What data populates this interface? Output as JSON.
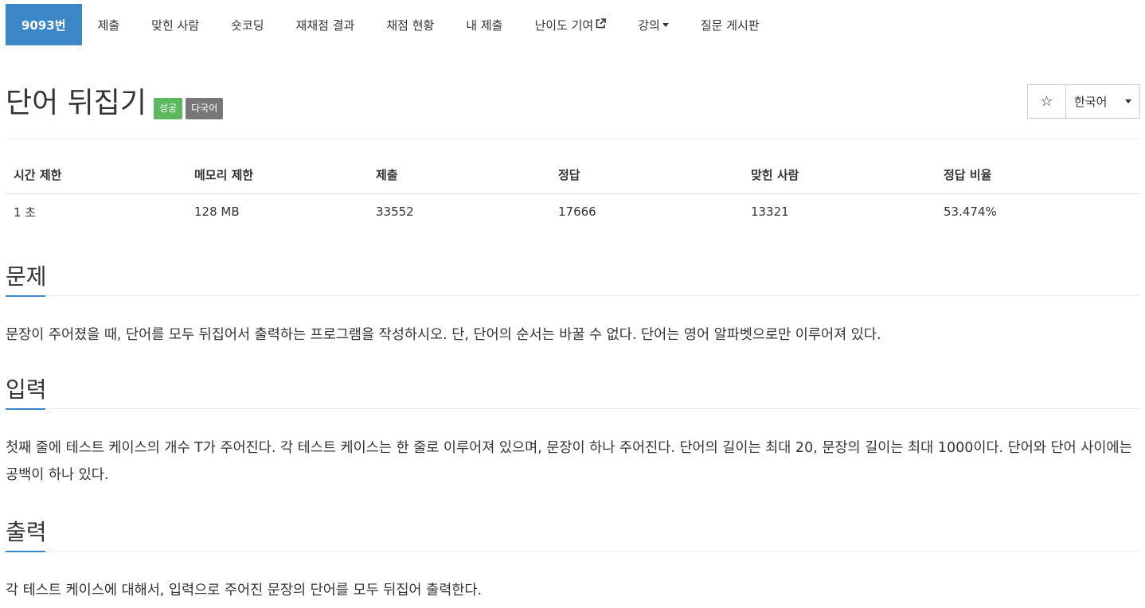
{
  "nav": {
    "problem_id": "9093번",
    "items": [
      "제출",
      "맞힌 사람",
      "숏코딩",
      "재채점 결과",
      "채점 현황",
      "내 제출",
      "난이도 기여",
      "강의",
      "질문 게시판"
    ]
  },
  "problem": {
    "title": "단어 뒤집기",
    "labels": [
      "성공",
      "다국어"
    ]
  },
  "toolbar": {
    "star": "☆",
    "language": "한국어"
  },
  "info": {
    "headers": [
      "시간 제한",
      "메모리 제한",
      "제출",
      "정답",
      "맞힌 사람",
      "정답 비율"
    ],
    "values": [
      "1 초",
      "128 MB",
      "33552",
      "17666",
      "13321",
      "53.474%"
    ]
  },
  "sections": {
    "problem": {
      "title": "문제",
      "text": "문장이 주어졌을 때, 단어를 모두 뒤집어서 출력하는 프로그램을 작성하시오. 단, 단어의 순서는 바꿀 수 없다. 단어는 영어 알파벳으로만 이루어져 있다."
    },
    "input": {
      "title": "입력",
      "text": "첫째 줄에 테스트 케이스의 개수 T가 주어진다. 각 테스트 케이스는 한 줄로 이루어져 있으며, 문장이 하나 주어진다. 단어의 길이는 최대 20, 문장의 길이는 최대 1000이다. 단어와 단어 사이에는 공백이 하나 있다."
    },
    "output": {
      "title": "출력",
      "text": "각 테스트 케이스에 대해서, 입력으로 주어진 문장의 단어를 모두 뒤집어 출력한다."
    }
  }
}
